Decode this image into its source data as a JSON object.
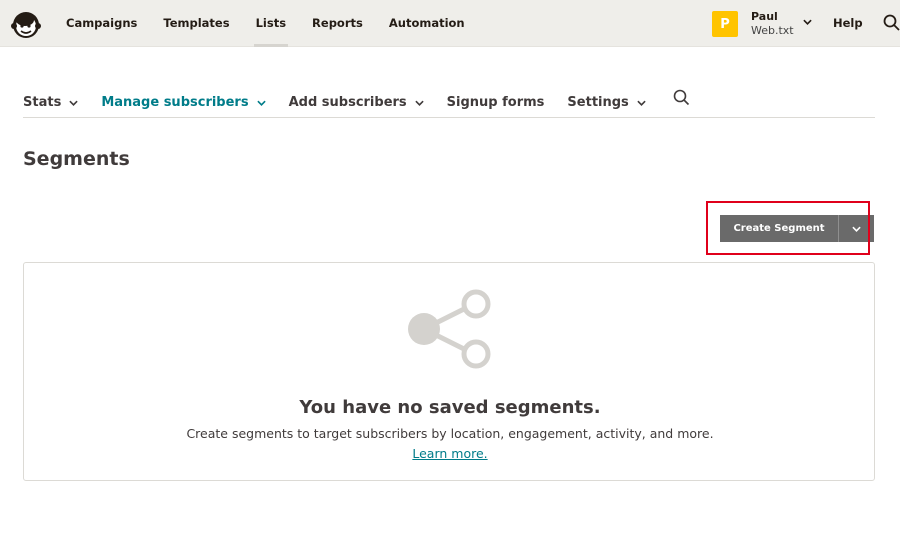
{
  "topbar": {
    "nav": [
      {
        "label": "Campaigns",
        "active": false
      },
      {
        "label": "Templates",
        "active": false
      },
      {
        "label": "Lists",
        "active": true
      },
      {
        "label": "Reports",
        "active": false
      },
      {
        "label": "Automation",
        "active": false
      }
    ],
    "account": {
      "initial": "P",
      "name": "Paul",
      "org": "Web.txt"
    },
    "help_label": "Help"
  },
  "subnav": {
    "items": [
      {
        "label": "Stats",
        "has_dropdown": true,
        "active": false
      },
      {
        "label": "Manage subscribers",
        "has_dropdown": true,
        "active": true
      },
      {
        "label": "Add subscribers",
        "has_dropdown": true,
        "active": false
      },
      {
        "label": "Signup forms",
        "has_dropdown": false,
        "active": false
      },
      {
        "label": "Settings",
        "has_dropdown": true,
        "active": false
      }
    ]
  },
  "page": {
    "title": "Segments"
  },
  "actions": {
    "create_label": "Create Segment"
  },
  "empty_state": {
    "icon": "share-icon",
    "title": "You have no saved segments.",
    "description": "Create segments to target subscribers by location, engagement, activity, and more.",
    "link_label": "Learn more."
  },
  "colors": {
    "topbar_bg": "#efeeea",
    "accent": "#007c89",
    "avatar": "#ffc400",
    "button": "#6a6a6a",
    "highlight": "#e0001b"
  }
}
